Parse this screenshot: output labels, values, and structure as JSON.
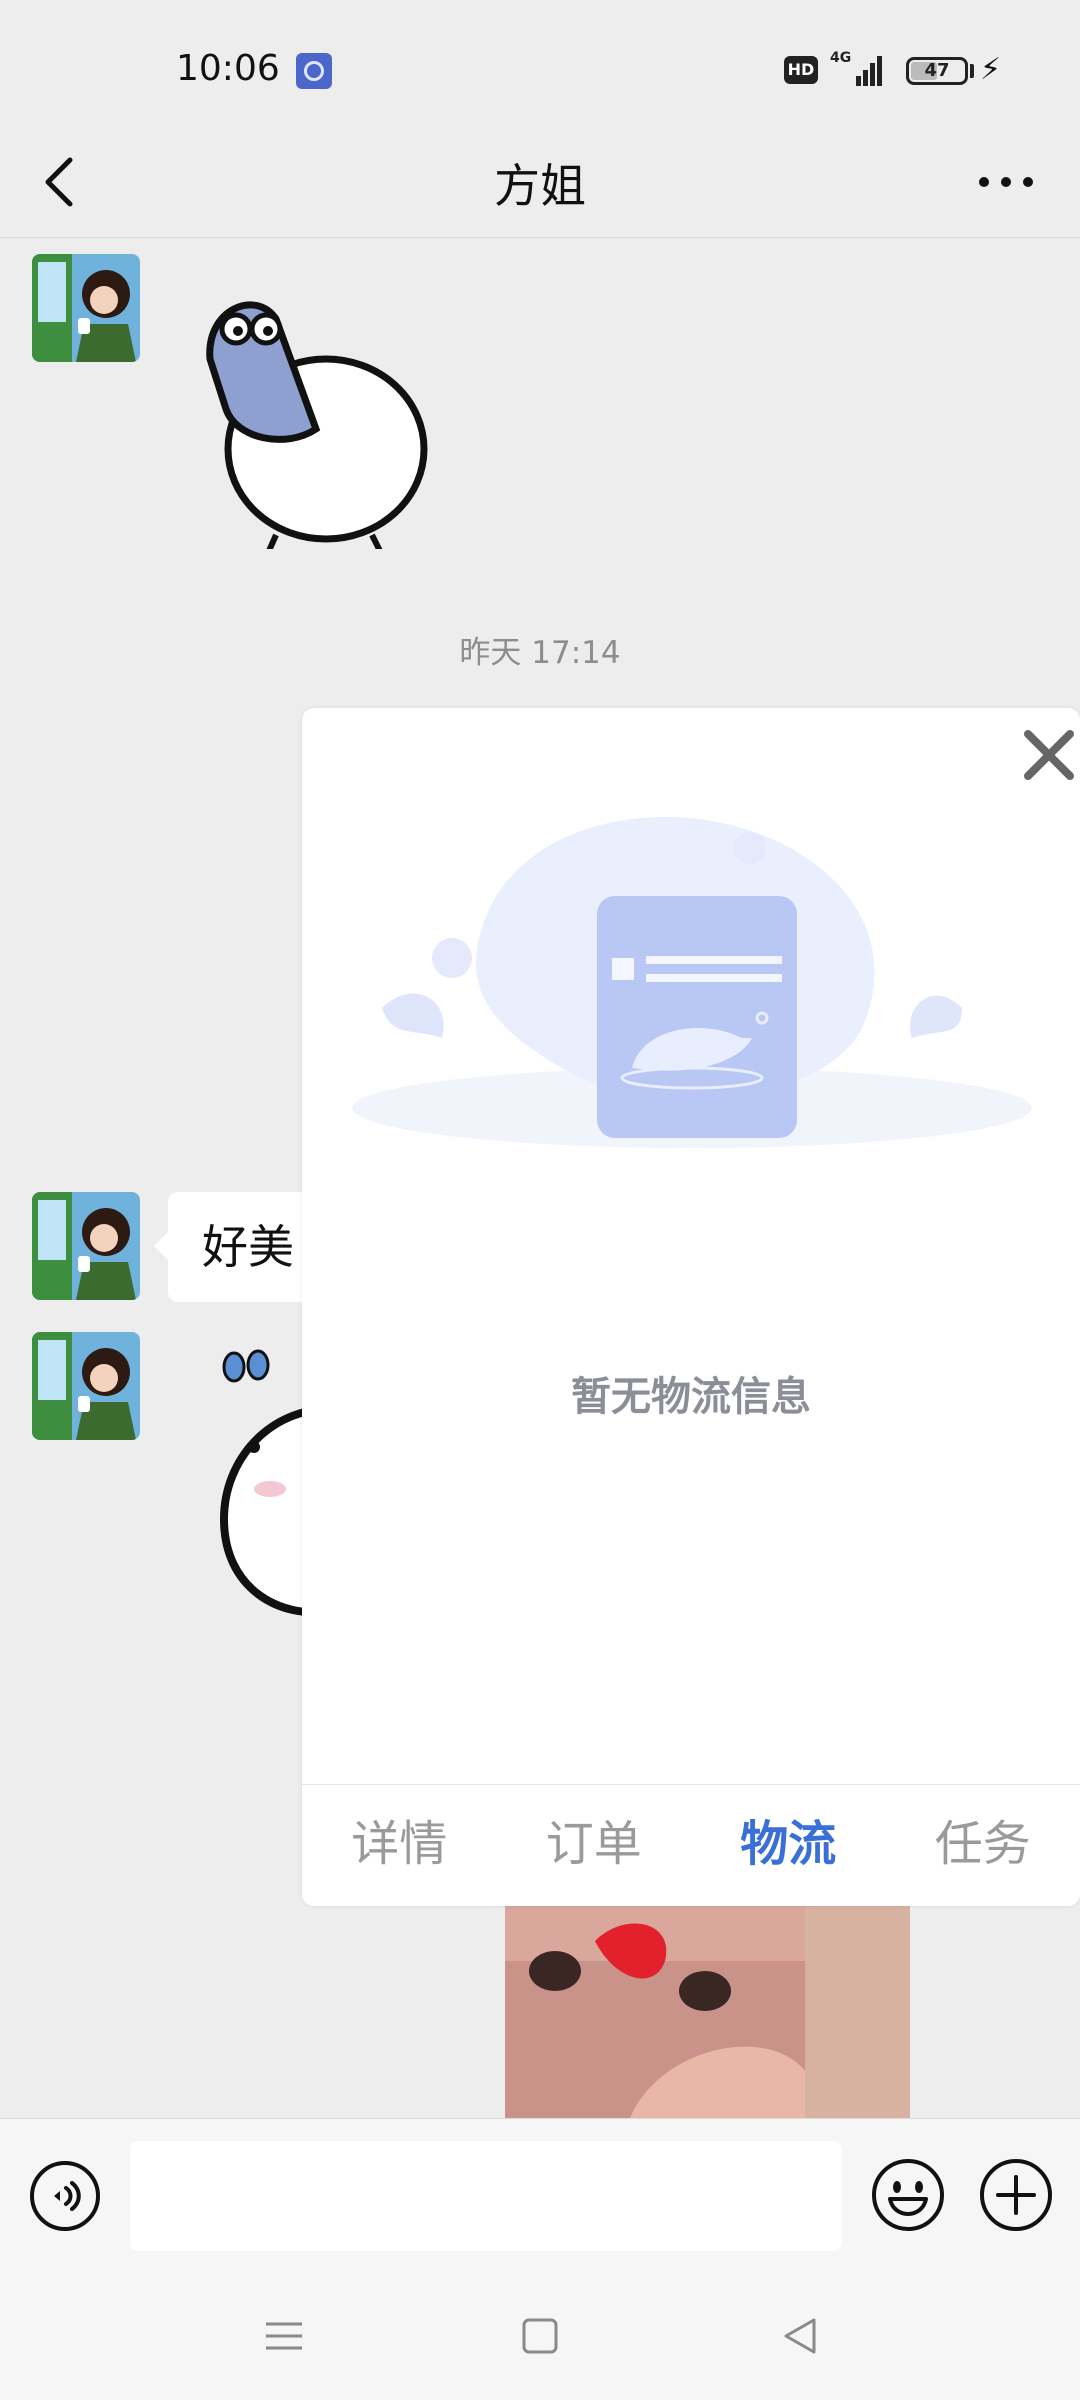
{
  "status_bar": {
    "time": "10:06",
    "hd_label": "HD",
    "network_label": "4G",
    "battery_level": "47"
  },
  "nav": {
    "title": "方姐"
  },
  "chat": {
    "timestamp": "昨天 17:14",
    "bubble_text": "好美"
  },
  "popup": {
    "empty_text": "暂无物流信息",
    "tabs": [
      {
        "label": "详情",
        "active": false
      },
      {
        "label": "订单",
        "active": false
      },
      {
        "label": "物流",
        "active": true
      },
      {
        "label": "任务",
        "active": false
      }
    ]
  },
  "input_bar": {
    "placeholder": ""
  },
  "colors": {
    "accent": "#3b6fd8",
    "background": "#ededed",
    "tab_inactive": "#9a9a9a"
  },
  "icons": {
    "back": "chevron-left-icon",
    "more": "more-dots-icon",
    "close": "close-icon",
    "voice": "voice-icon",
    "emoji": "emoji-icon",
    "plus": "plus-icon",
    "menu": "menu-icon",
    "home": "home-icon",
    "back_nav": "back-triangle-icon"
  }
}
